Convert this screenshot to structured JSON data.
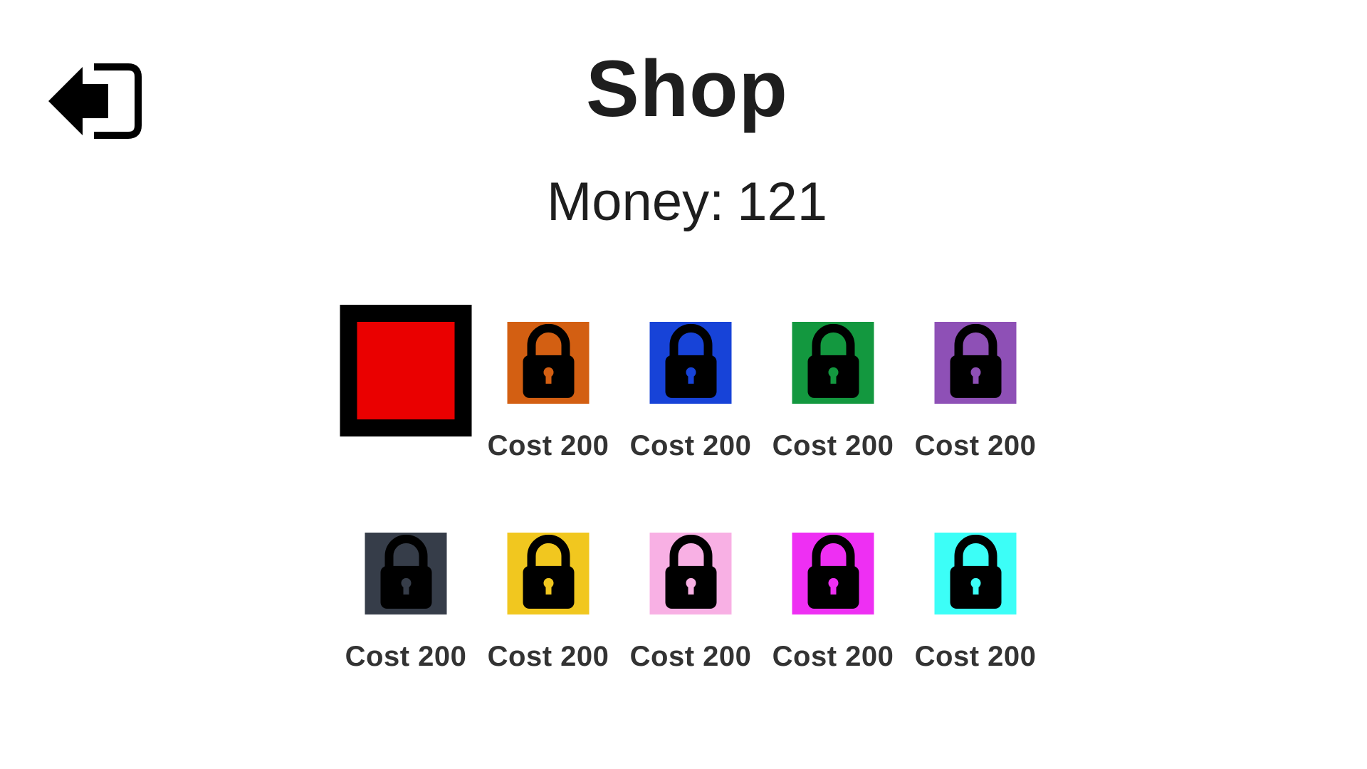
{
  "header": {
    "title": "Shop",
    "back_icon": "exit-arrow-icon"
  },
  "money": {
    "label": "Money:",
    "value": "121"
  },
  "items": [
    {
      "color": "#ea0000",
      "selected": true,
      "locked": false,
      "cost_label": ""
    },
    {
      "color": "#d35f12",
      "selected": false,
      "locked": true,
      "cost_label": "Cost 200"
    },
    {
      "color": "#1743d8",
      "selected": false,
      "locked": true,
      "cost_label": "Cost 200"
    },
    {
      "color": "#13983f",
      "selected": false,
      "locked": true,
      "cost_label": "Cost 200"
    },
    {
      "color": "#8e50b6",
      "selected": false,
      "locked": true,
      "cost_label": "Cost 200"
    },
    {
      "color": "#363d49",
      "selected": false,
      "locked": true,
      "cost_label": "Cost 200"
    },
    {
      "color": "#f1c71f",
      "selected": false,
      "locked": true,
      "cost_label": "Cost 200"
    },
    {
      "color": "#f8b0e4",
      "selected": false,
      "locked": true,
      "cost_label": "Cost 200"
    },
    {
      "color": "#ee2ff3",
      "selected": false,
      "locked": true,
      "cost_label": "Cost 200"
    },
    {
      "color": "#3cfef7",
      "selected": false,
      "locked": true,
      "cost_label": "Cost 200"
    }
  ]
}
